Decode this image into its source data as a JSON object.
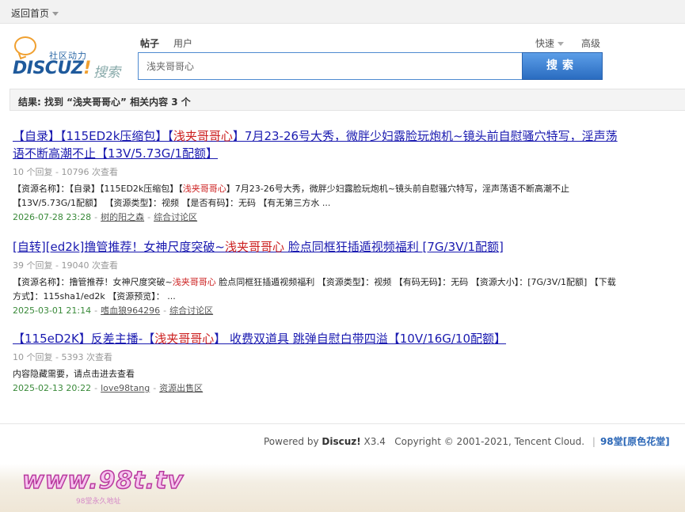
{
  "topbar": {
    "home_label": "返回首页"
  },
  "logo": {
    "tagline": "社区动力",
    "brand_main": "DISCUZ",
    "brand_excl": "!",
    "brand_suffix": "搜索"
  },
  "search": {
    "types": [
      "帖子",
      "用户"
    ],
    "quick_label": "快速",
    "advanced_label": "高级",
    "query": "浅夹哥哥心",
    "button_label": "搜索"
  },
  "result_summary": "结果: 找到 “浅夹哥哥心” 相关内容 3 个",
  "results": [
    {
      "title_pre": "【自录】【115ED2k压缩包】【",
      "title_hl": "浅夹哥哥心",
      "title_post": "】7月23-26号大秀，微胖少妇露脸玩炮机~镜头前自慰骚穴特写，淫声荡语不断高潮不止【13V/5.73G/1配额】",
      "stats": "10 个回复 - 10796 次查看",
      "desc_pre": "【资源名称】：【自录】【115ED2k压缩包】【",
      "desc_hl": "浅夹哥哥心",
      "desc_post": "】7月23-26号大秀，微胖少妇露脸玩炮机~镜头前自慰骚穴特写，淫声荡语不断高潮不止【13V/5.73G/1配额】 【资源类型】：视频 【是否有码】：无码 【有无第三方水 ...",
      "date": "2026-07-28 23:28",
      "author": "树的阳之森",
      "forum": "综合讨论区"
    },
    {
      "title_pre": "[自转][ed2k]撸管推荐！女神尺度突破~",
      "title_hl": "浅夹哥哥心",
      "title_post": " 脸点同框狂插遁视频福利 [7G/3V/1配额]",
      "stats": "39 个回复 - 19040 次查看",
      "desc_pre": "【资源名称】：撸管推荐！女神尺度突破~",
      "desc_hl": "浅夹哥哥心",
      "desc_post": " 脸点同框狂插遁视频福利 【资源类型】：视频 【有码无码】：无码 【资源大小】：[7G/3V/1配额] 【下载方式】：115sha1/ed2k 【资源预览】： ...",
      "date": "2025-03-01 21:14",
      "author": "嗜血狼964296",
      "forum": "综合讨论区"
    },
    {
      "title_pre": "【115eD2K】反差主播-【",
      "title_hl": "浅夹哥哥心",
      "title_post": "】 收费双道具 跳弹自慰白带四溢【10V/16G/10配额】",
      "stats": "10 个回复 - 5393 次查看",
      "desc_pre": "内容隐藏需要，请点击进去查看",
      "desc_hl": "",
      "desc_post": "",
      "date": "2025-02-13 20:22",
      "author": "love98tang",
      "forum": "资源出售区"
    }
  ],
  "footer": {
    "powered_pre": "Powered by ",
    "powered_brand": "Discuz!",
    "powered_ver": " X3.4",
    "copyright": "Copyright © 2001-2021, Tencent Cloud.",
    "separator": "|",
    "site_name": "98堂[原色花堂]"
  },
  "watermark": {
    "main": "www.98t.tv",
    "sub": "98堂永久地址"
  }
}
